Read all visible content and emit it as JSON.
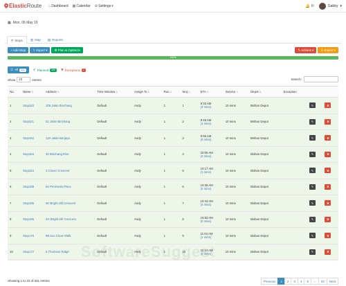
{
  "app": {
    "logo_part1": "Elastic",
    "logo_part2": "Route"
  },
  "nav": {
    "dashboard": "Dashboard",
    "calendar": "Calendar",
    "settings": "Settings"
  },
  "user": {
    "notifications": "0",
    "name": "Gabby"
  },
  "date": "Mon, 06 May 19",
  "tabs": {
    "stops": "Stops",
    "map": "Map",
    "reports": "Reports"
  },
  "buttons": {
    "add_stop": "Add Stop",
    "import": "Import",
    "plan": "Plan & Optimize",
    "actions": "Actions",
    "export": "Export"
  },
  "progress": {
    "label": "100%",
    "value": 100
  },
  "filters": {
    "all": "All",
    "all_count": "331",
    "planned": "Planned",
    "planned_count": "330",
    "exceptions": "Exceptions",
    "exceptions_count": "1"
  },
  "show": {
    "prefix": "Show",
    "value": "10",
    "suffix": "entries"
  },
  "search": {
    "label": "Search:"
  },
  "table": {
    "headers": [
      "No.",
      "Name",
      "Address",
      "Time Window",
      "Assign To",
      "Run",
      "Seq",
      "ETA",
      "Service",
      "Depot",
      "Exception"
    ],
    "rows": [
      {
        "no": "1",
        "name": "Stop322",
        "address": "109 Jalan Binchang",
        "window": "Default",
        "assign": "Andy",
        "run": "1",
        "seq": "1",
        "eta": "9:33 AM",
        "eta_sub": "(3 mins)",
        "service": "10 mins",
        "depot": "Bishan Depot"
      },
      {
        "no": "2",
        "name": "Stop321",
        "address": "31 Jalan Binchang",
        "window": "Default",
        "assign": "Andy",
        "run": "1",
        "seq": "2",
        "eta": "9:45 AM",
        "eta_sub": "(1 mins)",
        "service": "10 mins",
        "depot": "Bishan Depot"
      },
      {
        "no": "3",
        "name": "Stop162",
        "address": "13A Jalan Berjaya",
        "window": "Default",
        "assign": "Andy",
        "run": "1",
        "seq": "3",
        "eta": "9:56 AM",
        "eta_sub": "(0 mins)",
        "service": "10 mins",
        "depot": "Bishan Depot"
      },
      {
        "no": "4",
        "name": "Stop163",
        "address": "32 Binchang Rise",
        "window": "Default",
        "assign": "Andy",
        "run": "1",
        "seq": "4",
        "eta": "10:06 AM",
        "eta_sub": "(2 mins)",
        "service": "10 mins",
        "depot": "Bishan Depot"
      },
      {
        "no": "5",
        "name": "Stop323",
        "address": "2 Clover Crescent",
        "window": "Default",
        "assign": "Andy",
        "run": "1",
        "seq": "5",
        "eta": "10:17 AM",
        "eta_sub": "(1 mins)",
        "service": "10 mins",
        "depot": "Bishan Depot"
      },
      {
        "no": "6",
        "name": "Stop169",
        "address": "93 Peninsula Place",
        "window": "Default",
        "assign": "Andy",
        "run": "1",
        "seq": "6",
        "eta": "10:28 AM",
        "eta_sub": "(2 mins)",
        "service": "10 mins",
        "depot": "Bishan Depot"
      },
      {
        "no": "7",
        "name": "Stop165",
        "address": "3K Bright Hill Crescent",
        "window": "Default",
        "assign": "Andy",
        "run": "1",
        "seq": "7",
        "eta": "10:43 AM",
        "eta_sub": "(4 mins)",
        "service": "10 mins",
        "depot": "Bishan Depot"
      },
      {
        "no": "8",
        "name": "Stop166",
        "address": "2G Bright Hill Crescent",
        "window": "Default",
        "assign": "Andy",
        "run": "1",
        "seq": "8",
        "eta": "10:53 AM",
        "eta_sub": "(0 mins)",
        "service": "10 mins",
        "depot": "Bishan Depot"
      },
      {
        "no": "9",
        "name": "Stop170",
        "address": "99 Soo Chow Walk",
        "window": "Default",
        "assign": "Andy",
        "run": "1",
        "seq": "9",
        "eta": "11:04 AM",
        "eta_sub": "(1 mins)",
        "service": "10 mins",
        "depot": "Bishan Depot"
      },
      {
        "no": "10",
        "name": "Stop172",
        "address": "5 Thomson Ridge",
        "window": "Default",
        "assign": "Andy",
        "run": "1",
        "seq": "10",
        "eta": "11:14 AM",
        "eta_sub": "(0 mins)",
        "service": "10 mins",
        "depot": "Bishan Depot"
      }
    ]
  },
  "footer": {
    "info": "Showing 1 to 10 of 331 entries"
  },
  "pager": [
    "Previous",
    "1",
    "2",
    "3",
    "4",
    "5",
    "...",
    "34",
    "Next"
  ],
  "watermark": "SoftwareSuggest"
}
